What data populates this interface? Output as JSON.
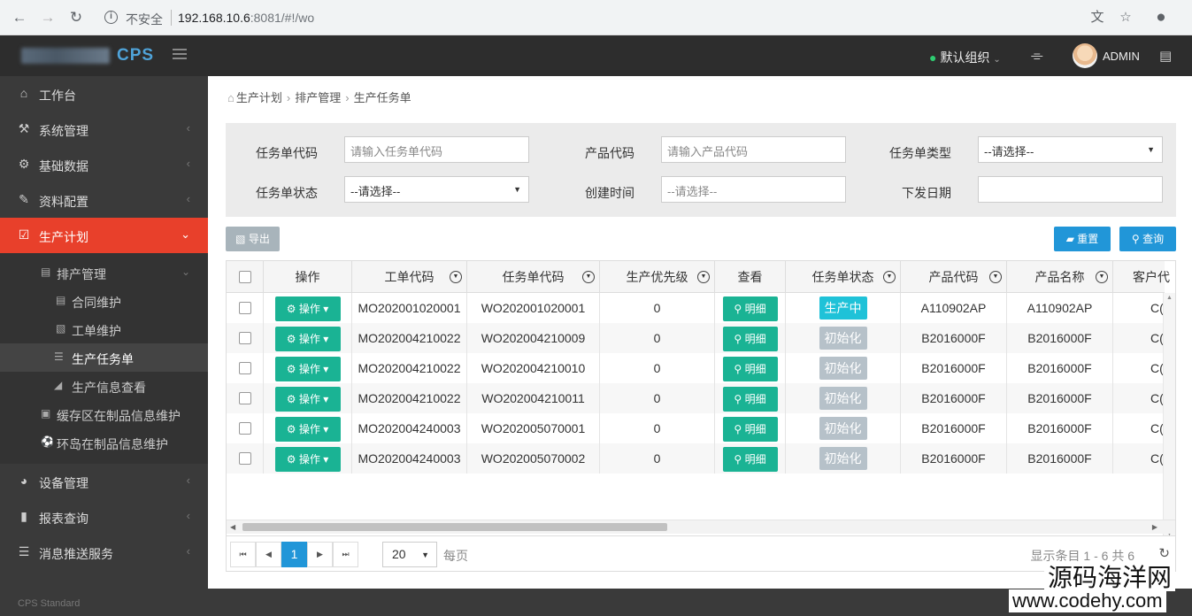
{
  "browser": {
    "insecure_label": "不安全",
    "url_host": "192.168.10.6",
    "url_rest": ":8081/#!/wo"
  },
  "topbar": {
    "logo": "CPS",
    "org_label": "默认组织",
    "user_name": "ADMIN"
  },
  "sidebar": {
    "items": [
      {
        "label": "工作台",
        "icon": "home-icon"
      },
      {
        "label": "系统管理",
        "icon": "wrench-icon"
      },
      {
        "label": "基础数据",
        "icon": "gear-icon"
      },
      {
        "label": "资料配置",
        "icon": "edit-icon"
      },
      {
        "label": "生产计划",
        "icon": "calendar-check-icon"
      },
      {
        "label": "设备管理",
        "icon": "dashboard-icon"
      },
      {
        "label": "报表查询",
        "icon": "bar-chart-icon"
      },
      {
        "label": "消息推送服务",
        "icon": "server-icon"
      }
    ],
    "sub_items": [
      {
        "label": "排产管理"
      },
      {
        "label": "合同维护"
      },
      {
        "label": "工单维护"
      },
      {
        "label": "生产任务单"
      },
      {
        "label": "生产信息查看"
      },
      {
        "label": "缓存区在制品信息维护"
      },
      {
        "label": "环岛在制品信息维护"
      }
    ],
    "footer": "CPS Standard"
  },
  "breadcrumb": [
    "生产计划",
    "排产管理",
    "生产任务单"
  ],
  "filter": {
    "task_code_label": "任务单代码",
    "task_code_placeholder": "请输入任务单代码",
    "product_code_label": "产品代码",
    "product_code_placeholder": "请输入产品代码",
    "task_type_label": "任务单类型",
    "task_type_value": "--请选择--",
    "task_status_label": "任务单状态",
    "task_status_value": "--请选择--",
    "create_time_label": "创建时间",
    "create_time_placeholder": "--请选择--",
    "issue_date_label": "下发日期"
  },
  "toolbar": {
    "export_label": "导出",
    "reset_label": "重置",
    "query_label": "查询"
  },
  "table": {
    "headers": [
      "操作",
      "工单代码",
      "任务单代码",
      "生产优先级",
      "查看",
      "任务单状态",
      "产品代码",
      "产品名称",
      "客户代"
    ],
    "op_label": "操作",
    "detail_label": "明细",
    "rows": [
      {
        "wo": "MO202001020001",
        "task": "WO202001020001",
        "priority": "0",
        "status": "生产中",
        "product_code": "A110902AP",
        "product_name": "A110902AP",
        "customer": "C("
      },
      {
        "wo": "MO202004210022",
        "task": "WO202004210009",
        "priority": "0",
        "status": "初始化",
        "product_code": "B2016000F",
        "product_name": "B2016000F",
        "customer": "C("
      },
      {
        "wo": "MO202004210022",
        "task": "WO202004210010",
        "priority": "0",
        "status": "初始化",
        "product_code": "B2016000F",
        "product_name": "B2016000F",
        "customer": "C("
      },
      {
        "wo": "MO202004210022",
        "task": "WO202004210011",
        "priority": "0",
        "status": "初始化",
        "product_code": "B2016000F",
        "product_name": "B2016000F",
        "customer": "C("
      },
      {
        "wo": "MO202004240003",
        "task": "WO202005070001",
        "priority": "0",
        "status": "初始化",
        "product_code": "B2016000F",
        "product_name": "B2016000F",
        "customer": "C("
      },
      {
        "wo": "MO202004240003",
        "task": "WO202005070002",
        "priority": "0",
        "status": "初始化",
        "product_code": "B2016000F",
        "product_name": "B2016000F",
        "customer": "C("
      }
    ]
  },
  "colors": {
    "status_running": "#1fc2d8",
    "status_init": "#b6c1c9",
    "accent": "#e8402b"
  },
  "pager": {
    "current_page": "1",
    "page_size": "20",
    "per_page_label": "每页",
    "info": "显示条目 1 - 6 共 6"
  },
  "watermark": {
    "cn": "源码海洋网",
    "url": "www.codehy.com"
  }
}
